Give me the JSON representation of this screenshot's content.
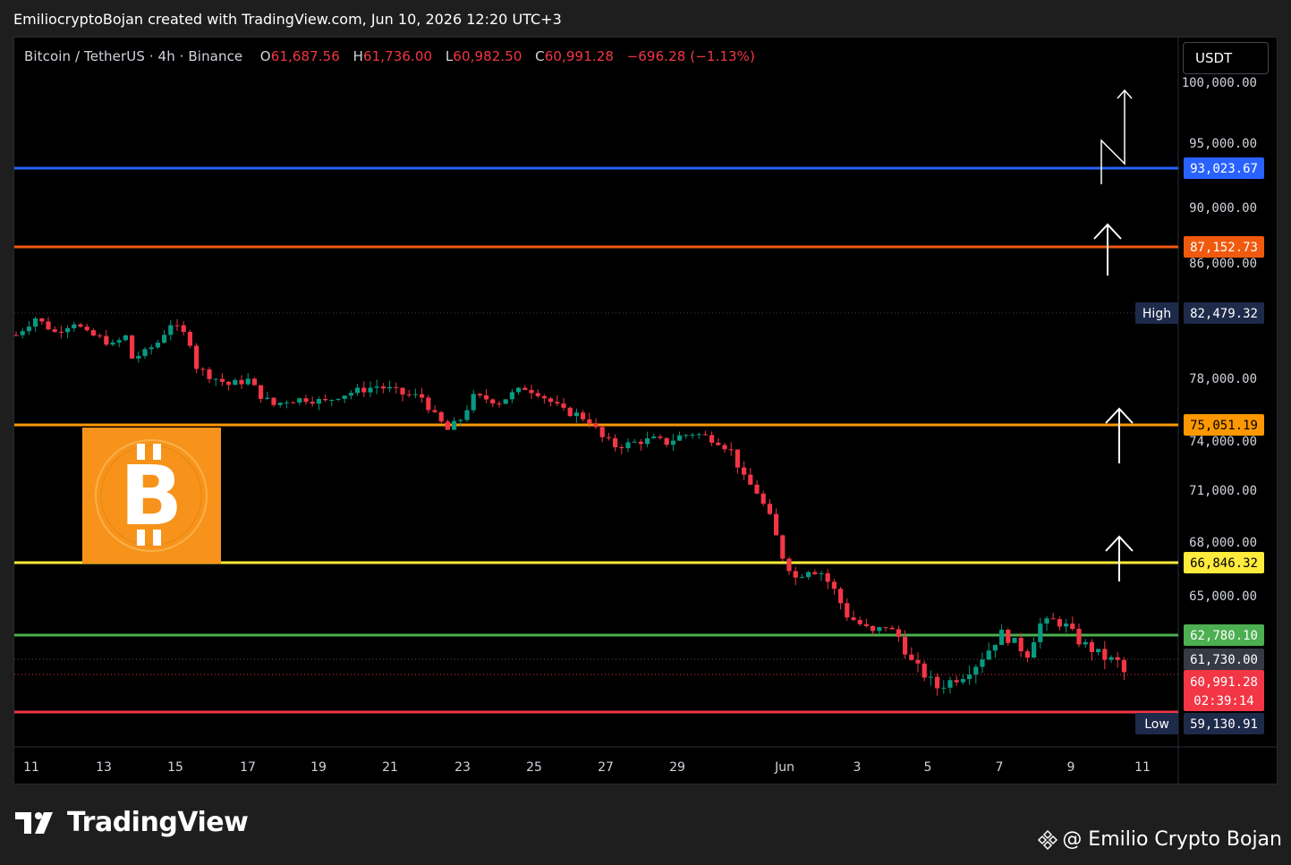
{
  "caption": "EmiliocryptoBojan created with TradingView.com, Jun 10, 2026 12:20 UTC+3",
  "legend": {
    "symbol": "Bitcoin / TetherUS · 4h · Binance",
    "o_key": "O",
    "o_val": "61,687.56",
    "h_key": "H",
    "h_val": "61,736.00",
    "l_key": "L",
    "l_val": "60,982.50",
    "c_key": "C",
    "c_val": "60,991.28",
    "change": "−696.28 (−1.13%)"
  },
  "currency": "USDT",
  "branding": "TradingView",
  "credit": "@ Emilio Crypto Bojan",
  "colors": {
    "up": "#089981",
    "down": "#f23645",
    "background": "#000000",
    "blue_line": "#2962ff",
    "orange_dark": "#f05a0f",
    "orange": "#ff9800",
    "yellow": "#ffeb3b",
    "green": "#4caf50",
    "red_line": "#f23645",
    "btc": "#f7931a"
  },
  "chart_data": {
    "type": "candlestick",
    "timeframe": "4h",
    "y_axis_ticks": [
      "100,000.00",
      "95,000.00",
      "90,000.00",
      "86,000.00",
      "78,000.00",
      "74,000.00",
      "71,000.00",
      "68,000.00",
      "65,000.00"
    ],
    "x_axis_ticks": [
      "11",
      "13",
      "15",
      "17",
      "19",
      "21",
      "23",
      "25",
      "27",
      "29",
      "Jun",
      "3",
      "5",
      "7",
      "9",
      "11"
    ],
    "horizontal_levels": [
      {
        "value": 93023.67,
        "label": "93,023.67",
        "color": "#2962ff"
      },
      {
        "value": 87152.73,
        "label": "87,152.73",
        "color": "#f05a0f"
      },
      {
        "value": 75051.19,
        "label": "75,051.19",
        "color": "#ff9800"
      },
      {
        "value": 66846.32,
        "label": "66,846.32",
        "color": "#ffeb3b"
      },
      {
        "value": 62780.1,
        "label": "62,780.10",
        "color": "#4caf50"
      },
      {
        "value": 59130.91,
        "label": "59,130.91",
        "color": "#f23645"
      }
    ],
    "high": {
      "label": "High",
      "value": "82,479.32"
    },
    "low": {
      "label": "Low",
      "value": "59,130.91"
    },
    "current_price": "61,730.00",
    "last_close": "60,991.28",
    "countdown": "02:39:14",
    "close_path": [
      [
        0,
        81000
      ],
      [
        3,
        82200
      ],
      [
        6,
        81200
      ],
      [
        9,
        81900
      ],
      [
        11,
        81100
      ],
      [
        13,
        80800
      ],
      [
        15,
        80300
      ],
      [
        17,
        80900
      ],
      [
        18,
        79400
      ],
      [
        20,
        79800
      ],
      [
        22,
        80500
      ],
      [
        24,
        81800
      ],
      [
        26,
        81100
      ],
      [
        27,
        80500
      ],
      [
        28,
        78800
      ],
      [
        30,
        78200
      ],
      [
        33,
        77600
      ],
      [
        36,
        77900
      ],
      [
        38,
        76900
      ],
      [
        40,
        76300
      ],
      [
        42,
        76600
      ],
      [
        45,
        76700
      ],
      [
        48,
        76500
      ],
      [
        50,
        76900
      ],
      [
        53,
        77200
      ],
      [
        56,
        77500
      ],
      [
        58,
        77300
      ],
      [
        60,
        77000
      ],
      [
        63,
        76800
      ],
      [
        65,
        75600
      ],
      [
        67,
        74700
      ],
      [
        69,
        75400
      ],
      [
        71,
        76800
      ],
      [
        73,
        76700
      ],
      [
        75,
        76500
      ],
      [
        77,
        77000
      ],
      [
        79,
        77400
      ],
      [
        81,
        77100
      ],
      [
        83,
        76500
      ],
      [
        85,
        75900
      ],
      [
        87,
        75700
      ],
      [
        89,
        75300
      ],
      [
        91,
        74200
      ],
      [
        93,
        73700
      ],
      [
        95,
        73800
      ],
      [
        97,
        74000
      ],
      [
        99,
        74100
      ],
      [
        101,
        73900
      ],
      [
        103,
        74300
      ],
      [
        105,
        74500
      ],
      [
        107,
        74300
      ],
      [
        109,
        74000
      ],
      [
        111,
        73400
      ],
      [
        113,
        71700
      ],
      [
        115,
        70900
      ],
      [
        117,
        69400
      ],
      [
        119,
        67200
      ],
      [
        121,
        66000
      ],
      [
        123,
        66500
      ],
      [
        125,
        66300
      ],
      [
        127,
        65300
      ],
      [
        129,
        63900
      ],
      [
        131,
        63400
      ],
      [
        133,
        62900
      ],
      [
        135,
        63300
      ],
      [
        137,
        62700
      ],
      [
        139,
        61500
      ],
      [
        141,
        60900
      ],
      [
        143,
        60300
      ],
      [
        145,
        60600
      ],
      [
        147,
        60900
      ],
      [
        149,
        61400
      ],
      [
        151,
        62100
      ],
      [
        153,
        62900
      ],
      [
        155,
        62400
      ],
      [
        157,
        61900
      ],
      [
        159,
        63400
      ],
      [
        161,
        63600
      ],
      [
        163,
        63300
      ],
      [
        165,
        62500
      ],
      [
        167,
        62100
      ],
      [
        169,
        61700
      ],
      [
        171,
        61500
      ],
      [
        172,
        60991
      ]
    ],
    "annotations": [
      "white zigzag arrow up near 93,023.67",
      "up arrow to 87,152.73",
      "up arrow to 75,051.19",
      "up arrow to 66,846.32",
      "bitcoin logo"
    ]
  }
}
